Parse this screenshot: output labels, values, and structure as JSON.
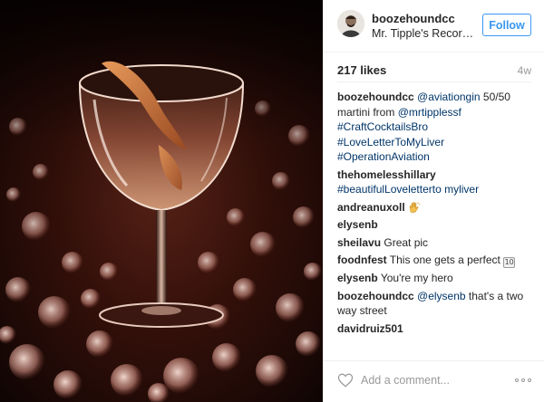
{
  "post": {
    "image_alt": "Martini in a coupe glass with orange twist over bokeh lights",
    "header": {
      "username": "boozehoundcc",
      "location": "Mr. Tipple's Recordin...",
      "follow_label": "Follow"
    },
    "likes": "217 likes",
    "age": "4w",
    "comments": [
      {
        "user": "boozehoundcc",
        "parts": [
          {
            "kind": "tag",
            "text": "@aviationgin"
          },
          {
            "kind": "text",
            "text": " 50/50 martini from "
          },
          {
            "kind": "tag",
            "text": "@mrtipplessf"
          },
          {
            "kind": "text",
            "text": " "
          },
          {
            "kind": "tag",
            "text": "#CraftCocktailsBro"
          },
          {
            "kind": "text",
            "text": " "
          },
          {
            "kind": "tag",
            "text": "#LoveLetterToMyLiver"
          },
          {
            "kind": "text",
            "text": " "
          },
          {
            "kind": "tag",
            "text": "#OperationAviation"
          }
        ]
      },
      {
        "user": "thehomelesshillary",
        "parts": [
          {
            "kind": "tag",
            "text": "#beautifulLoveletterto myliver"
          }
        ]
      },
      {
        "user": "andreanuxoll",
        "parts": [
          {
            "kind": "emoji",
            "name": "clapping-hands-emoji"
          }
        ]
      },
      {
        "user": "elysenb",
        "parts": []
      },
      {
        "user": "sheilavu",
        "parts": [
          {
            "kind": "text",
            "text": "Great pic"
          }
        ]
      },
      {
        "user": "foodnfest",
        "parts": [
          {
            "kind": "text",
            "text": "This one gets a perfect "
          },
          {
            "kind": "emoji",
            "name": "keycap-ten-emoji",
            "text": "10"
          }
        ]
      },
      {
        "user": "elysenb",
        "parts": [
          {
            "kind": "text",
            "text": "You're my hero"
          }
        ]
      },
      {
        "user": "boozehoundcc",
        "parts": [
          {
            "kind": "tag",
            "text": "@elysenb"
          },
          {
            "kind": "text",
            "text": " that's a two way street"
          }
        ]
      },
      {
        "user": "davidruiz501",
        "parts": []
      }
    ],
    "footer": {
      "like_icon": "heart-outline-icon",
      "comment_placeholder": "Add a comment...",
      "more_icon": "more-options-icon"
    },
    "colors": {
      "link": "#003569",
      "follow_blue": "#3897f0",
      "muted": "#999999",
      "text": "#262626"
    }
  }
}
